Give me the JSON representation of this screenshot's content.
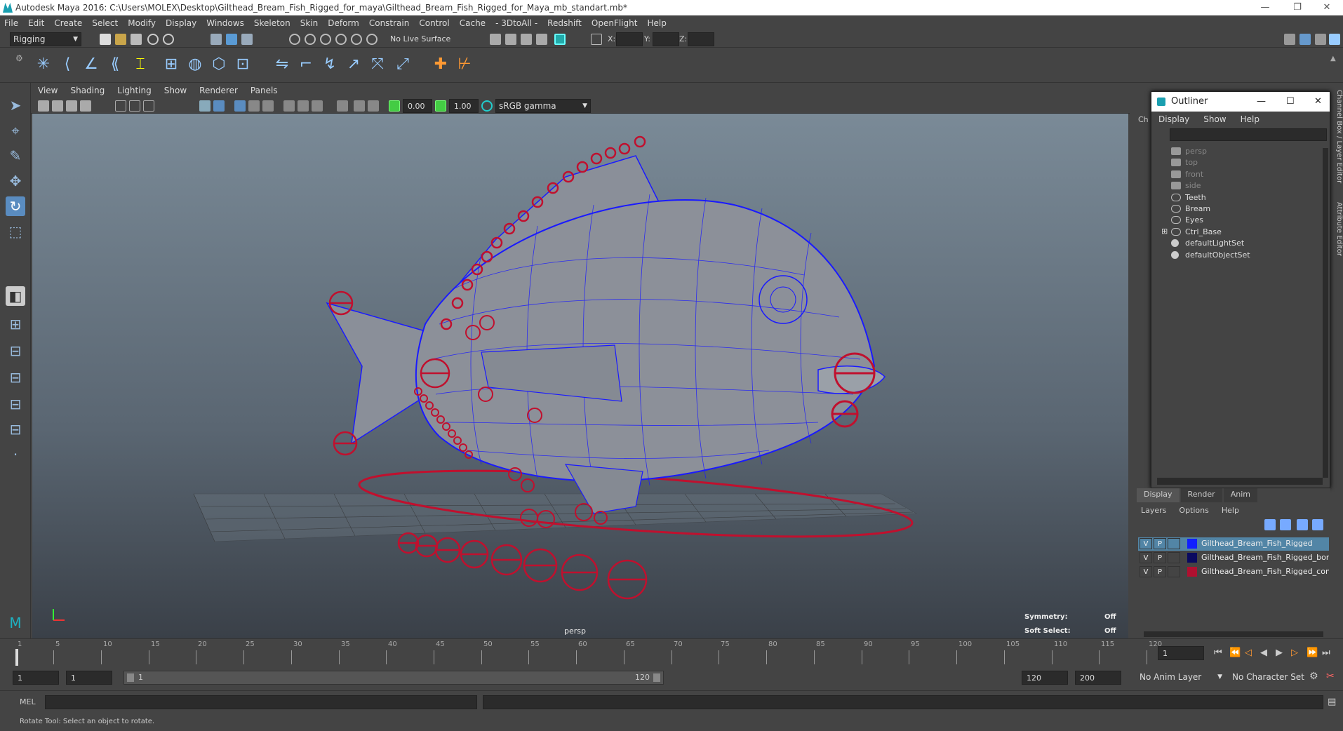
{
  "window": {
    "title": "Autodesk Maya 2016: C:\\Users\\MOLEX\\Desktop\\Gilthead_Bream_Fish_Rigged_for_maya\\Gilthead_Bream_Fish_Rigged_for_Maya_mb_standart.mb*",
    "minimize": "—",
    "restore": "❐",
    "close": "✕"
  },
  "menubar": [
    "File",
    "Edit",
    "Create",
    "Select",
    "Modify",
    "Display",
    "Windows",
    "Skeleton",
    "Skin",
    "Deform",
    "Constrain",
    "Control",
    "Cache",
    "- 3DtoAll -",
    "Redshift",
    "OpenFlight",
    "Help"
  ],
  "statusline": {
    "mode": "Rigging",
    "live_surface": "No Live Surface",
    "x_label": "X:",
    "y_label": "Y:",
    "z_label": "Z:"
  },
  "panel_menu": [
    "View",
    "Shading",
    "Lighting",
    "Show",
    "Renderer",
    "Panels"
  ],
  "panel_toolbar": {
    "exposure": "0.00",
    "gamma": "1.00",
    "colorspace": "sRGB gamma"
  },
  "viewport": {
    "camera_label": "persp",
    "symmetry_label": "Symmetry:",
    "symmetry_value": "Off",
    "soft_select_label": "Soft Select:",
    "soft_select_value": "Off"
  },
  "outliner": {
    "title": "Outliner",
    "menu": [
      "Display",
      "Show",
      "Help"
    ],
    "items": [
      {
        "label": "persp",
        "dim": true,
        "icon": "camera-icon"
      },
      {
        "label": "top",
        "dim": true,
        "icon": "camera-icon"
      },
      {
        "label": "front",
        "dim": true,
        "icon": "camera-icon"
      },
      {
        "label": "side",
        "dim": true,
        "icon": "camera-icon"
      },
      {
        "label": "Teeth",
        "dim": false,
        "icon": "mesh-icon"
      },
      {
        "label": "Bream",
        "dim": false,
        "icon": "mesh-icon"
      },
      {
        "label": "Eyes",
        "dim": false,
        "icon": "mesh-icon"
      },
      {
        "label": "Ctrl_Base",
        "dim": false,
        "icon": "mesh-icon",
        "expandable": true
      },
      {
        "label": "defaultLightSet",
        "dim": false,
        "icon": "set-icon"
      },
      {
        "label": "defaultObjectSet",
        "dim": false,
        "icon": "set-icon"
      }
    ],
    "side_tab_channel": "Ch"
  },
  "side_tabs": [
    "Channel Box / Layer Editor",
    "Attribute Editor"
  ],
  "layer_editor": {
    "tabs": [
      "Display",
      "Render",
      "Anim"
    ],
    "menu": [
      "Layers",
      "Options",
      "Help"
    ],
    "layers": [
      {
        "v": "V",
        "p": "P",
        "color": "#1020ff",
        "name": "Gilthead_Bream_Fish_Rigged",
        "selected": true
      },
      {
        "v": "V",
        "p": "P",
        "color": "#0a0a60",
        "name": "Gilthead_Bream_Fish_Rigged_bone",
        "selected": false
      },
      {
        "v": "V",
        "p": "P",
        "color": "#b01030",
        "name": "Gilthead_Bream_Fish_Rigged_contr",
        "selected": false
      }
    ]
  },
  "timeline": {
    "ticks": [
      "1",
      "5",
      "10",
      "15",
      "20",
      "25",
      "30",
      "35",
      "40",
      "45",
      "50",
      "55",
      "60",
      "65",
      "70",
      "75",
      "80",
      "85",
      "90",
      "95",
      "100",
      "105",
      "110",
      "115",
      "120"
    ],
    "current_frame": "1"
  },
  "range": {
    "start": "1",
    "playback_start": "1",
    "slider_start": "1",
    "slider_end": "120",
    "playback_end": "120",
    "end": "200",
    "anim_layer": "No Anim Layer",
    "character_set": "No Character Set"
  },
  "command_line": {
    "label": "MEL"
  },
  "help_line": "Rotate Tool: Select an object to rotate.",
  "colors": {
    "mesh_wire": "#1a1aff",
    "control": "#c0102e",
    "bg_dark": "#444444"
  }
}
